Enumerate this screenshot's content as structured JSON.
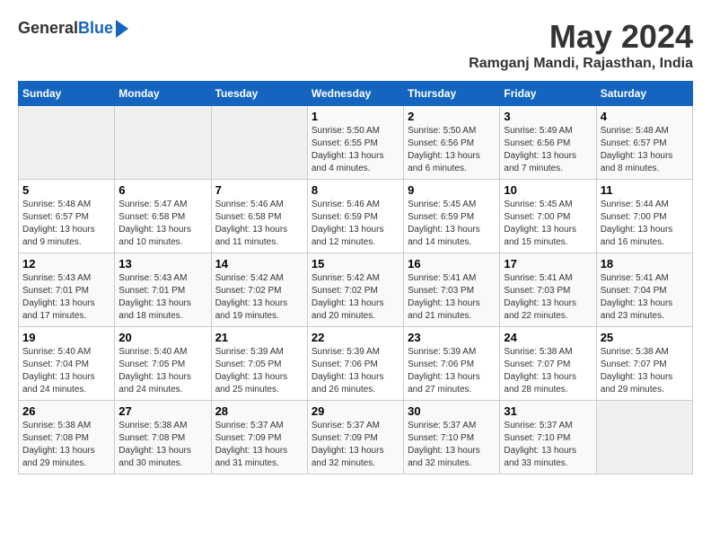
{
  "header": {
    "logo_general": "General",
    "logo_blue": "Blue",
    "title": "May 2024",
    "subtitle": "Ramganj Mandi, Rajasthan, India"
  },
  "days_of_week": [
    "Sunday",
    "Monday",
    "Tuesday",
    "Wednesday",
    "Thursday",
    "Friday",
    "Saturday"
  ],
  "weeks": [
    [
      {
        "day": "",
        "info": ""
      },
      {
        "day": "",
        "info": ""
      },
      {
        "day": "",
        "info": ""
      },
      {
        "day": "1",
        "info": "Sunrise: 5:50 AM\nSunset: 6:55 PM\nDaylight: 13 hours and 4 minutes."
      },
      {
        "day": "2",
        "info": "Sunrise: 5:50 AM\nSunset: 6:56 PM\nDaylight: 13 hours and 6 minutes."
      },
      {
        "day": "3",
        "info": "Sunrise: 5:49 AM\nSunset: 6:56 PM\nDaylight: 13 hours and 7 minutes."
      },
      {
        "day": "4",
        "info": "Sunrise: 5:48 AM\nSunset: 6:57 PM\nDaylight: 13 hours and 8 minutes."
      }
    ],
    [
      {
        "day": "5",
        "info": "Sunrise: 5:48 AM\nSunset: 6:57 PM\nDaylight: 13 hours and 9 minutes."
      },
      {
        "day": "6",
        "info": "Sunrise: 5:47 AM\nSunset: 6:58 PM\nDaylight: 13 hours and 10 minutes."
      },
      {
        "day": "7",
        "info": "Sunrise: 5:46 AM\nSunset: 6:58 PM\nDaylight: 13 hours and 11 minutes."
      },
      {
        "day": "8",
        "info": "Sunrise: 5:46 AM\nSunset: 6:59 PM\nDaylight: 13 hours and 12 minutes."
      },
      {
        "day": "9",
        "info": "Sunrise: 5:45 AM\nSunset: 6:59 PM\nDaylight: 13 hours and 14 minutes."
      },
      {
        "day": "10",
        "info": "Sunrise: 5:45 AM\nSunset: 7:00 PM\nDaylight: 13 hours and 15 minutes."
      },
      {
        "day": "11",
        "info": "Sunrise: 5:44 AM\nSunset: 7:00 PM\nDaylight: 13 hours and 16 minutes."
      }
    ],
    [
      {
        "day": "12",
        "info": "Sunrise: 5:43 AM\nSunset: 7:01 PM\nDaylight: 13 hours and 17 minutes."
      },
      {
        "day": "13",
        "info": "Sunrise: 5:43 AM\nSunset: 7:01 PM\nDaylight: 13 hours and 18 minutes."
      },
      {
        "day": "14",
        "info": "Sunrise: 5:42 AM\nSunset: 7:02 PM\nDaylight: 13 hours and 19 minutes."
      },
      {
        "day": "15",
        "info": "Sunrise: 5:42 AM\nSunset: 7:02 PM\nDaylight: 13 hours and 20 minutes."
      },
      {
        "day": "16",
        "info": "Sunrise: 5:41 AM\nSunset: 7:03 PM\nDaylight: 13 hours and 21 minutes."
      },
      {
        "day": "17",
        "info": "Sunrise: 5:41 AM\nSunset: 7:03 PM\nDaylight: 13 hours and 22 minutes."
      },
      {
        "day": "18",
        "info": "Sunrise: 5:41 AM\nSunset: 7:04 PM\nDaylight: 13 hours and 23 minutes."
      }
    ],
    [
      {
        "day": "19",
        "info": "Sunrise: 5:40 AM\nSunset: 7:04 PM\nDaylight: 13 hours and 24 minutes."
      },
      {
        "day": "20",
        "info": "Sunrise: 5:40 AM\nSunset: 7:05 PM\nDaylight: 13 hours and 24 minutes."
      },
      {
        "day": "21",
        "info": "Sunrise: 5:39 AM\nSunset: 7:05 PM\nDaylight: 13 hours and 25 minutes."
      },
      {
        "day": "22",
        "info": "Sunrise: 5:39 AM\nSunset: 7:06 PM\nDaylight: 13 hours and 26 minutes."
      },
      {
        "day": "23",
        "info": "Sunrise: 5:39 AM\nSunset: 7:06 PM\nDaylight: 13 hours and 27 minutes."
      },
      {
        "day": "24",
        "info": "Sunrise: 5:38 AM\nSunset: 7:07 PM\nDaylight: 13 hours and 28 minutes."
      },
      {
        "day": "25",
        "info": "Sunrise: 5:38 AM\nSunset: 7:07 PM\nDaylight: 13 hours and 29 minutes."
      }
    ],
    [
      {
        "day": "26",
        "info": "Sunrise: 5:38 AM\nSunset: 7:08 PM\nDaylight: 13 hours and 29 minutes."
      },
      {
        "day": "27",
        "info": "Sunrise: 5:38 AM\nSunset: 7:08 PM\nDaylight: 13 hours and 30 minutes."
      },
      {
        "day": "28",
        "info": "Sunrise: 5:37 AM\nSunset: 7:09 PM\nDaylight: 13 hours and 31 minutes."
      },
      {
        "day": "29",
        "info": "Sunrise: 5:37 AM\nSunset: 7:09 PM\nDaylight: 13 hours and 32 minutes."
      },
      {
        "day": "30",
        "info": "Sunrise: 5:37 AM\nSunset: 7:10 PM\nDaylight: 13 hours and 32 minutes."
      },
      {
        "day": "31",
        "info": "Sunrise: 5:37 AM\nSunset: 7:10 PM\nDaylight: 13 hours and 33 minutes."
      },
      {
        "day": "",
        "info": ""
      }
    ]
  ]
}
